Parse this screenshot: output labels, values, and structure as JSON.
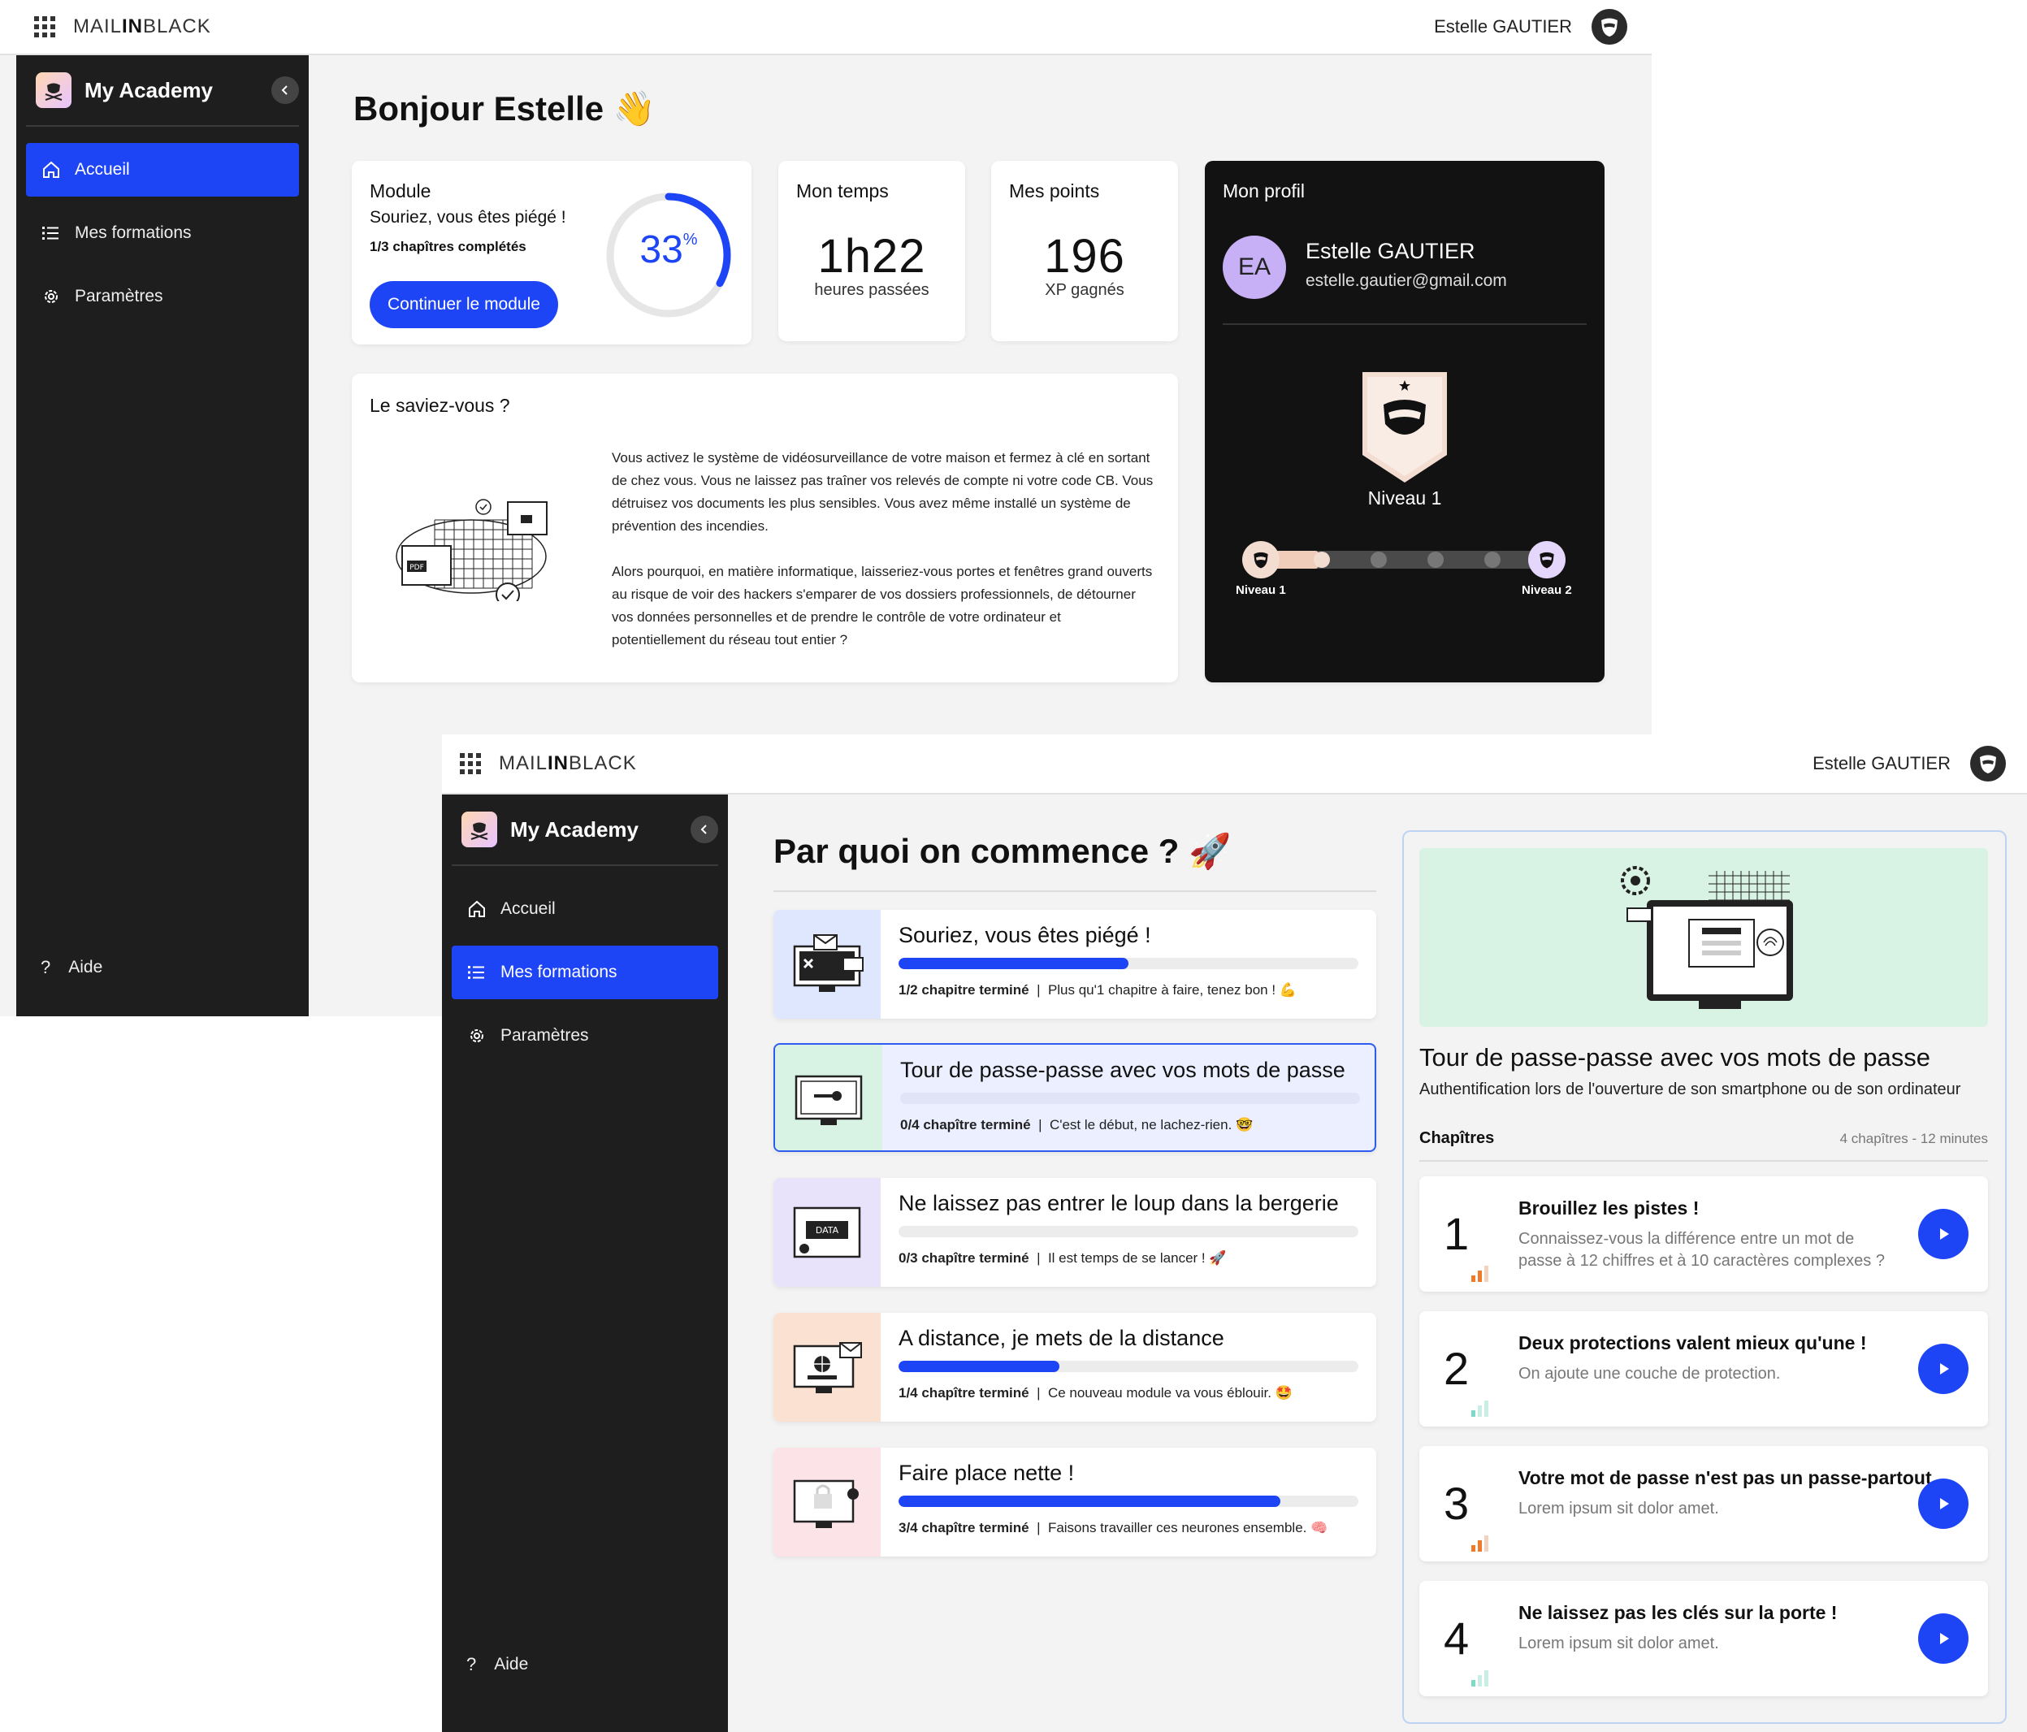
{
  "brand": {
    "prefix": "MAIL",
    "bold": "IN",
    "suffix": "BLACK"
  },
  "user": {
    "name": "Estelle GAUTIER"
  },
  "sidebar": {
    "title": "My Academy",
    "items": [
      {
        "label": "Accueil"
      },
      {
        "label": "Mes formations"
      },
      {
        "label": "Paramètres"
      }
    ],
    "help": "Aide"
  },
  "dashboard": {
    "greeting": "Bonjour Estelle",
    "greeting_emoji": "👋",
    "module": {
      "title": "Module",
      "name": "Souriez, vous êtes piégé !",
      "chapters": "1/3 chapîtres complétés",
      "button": "Continuer le module",
      "progress_value": "33",
      "progress_unit": "%",
      "progress_fraction": 0.33
    },
    "time": {
      "title": "Mon temps",
      "value": "1h22",
      "caption": "heures passées"
    },
    "points": {
      "title": "Mes points",
      "value": "196",
      "caption": "XP gagnés"
    },
    "tip": {
      "title": "Le saviez-vous ?",
      "para1": "Vous activez le système de vidéosurveillance de votre maison et fermez à clé en sortant de chez vous. Vous ne laissez pas traîner vos relevés de compte ni votre code CB. Vous détruisez vos documents les plus sensibles. Vous avez même installé un système de prévention des incendies.",
      "para2": "Alors pourquoi, en matière informatique, laisseriez-vous portes et fenêtres grand ouverts au risque de voir des hackers s'emparer de vos dossiers professionnels, de détourner vos données personnelles et de prendre le contrôle de votre ordinateur et potentiellement du réseau tout entier ?",
      "pdf_label": "PDF"
    },
    "profile": {
      "title": "Mon profil",
      "initials": "EA",
      "name": "Estelle GAUTIER",
      "email": "estelle.gautier@gmail.com",
      "level": "Niveau 1",
      "level_from": "Niveau 1",
      "level_to": "Niveau 2",
      "level_progress_fraction": 0.2
    }
  },
  "formations": {
    "title": "Par quoi on commence ?",
    "title_emoji": "🚀",
    "modules": [
      {
        "title": "Souriez, vous êtes piégé !",
        "chapters": "1/2 chapitre terminé",
        "message": "Plus qu'1 chapitre à faire, tenez bon !",
        "emoji": "💪",
        "progress": 0.5,
        "color": "#dfe7ff"
      },
      {
        "title": "Tour de passe-passe avec vos mots de passe",
        "chapters": "0/4 chapître terminé",
        "message": "C'est le début, ne lachez-rien.",
        "emoji": "🤓",
        "progress": 0.0,
        "color": "#d8f3e4"
      },
      {
        "title": "Ne laissez pas entrer le loup dans la bergerie",
        "chapters": "0/3 chapître terminé",
        "message": "Il est temps de se lancer !",
        "emoji": "🚀",
        "progress": 0.0,
        "color": "#e8e2fb",
        "thumb_label": "DATA"
      },
      {
        "title": "A distance, je mets de la distance",
        "chapters": "1/4 chapître terminé",
        "message": "Ce nouveau module va vous éblouir.",
        "emoji": "🤩",
        "progress": 0.35,
        "color": "#fbe1d2"
      },
      {
        "title": "Faire place nette !",
        "chapters": "3/4 chapître terminé",
        "message": "Faisons travailler ces neurones ensemble.",
        "emoji": "🧠",
        "progress": 0.83,
        "color": "#fbe3e8"
      }
    ],
    "detail": {
      "title": "Tour de passe-passe avec vos mots de passe",
      "subtitle": "Authentification lors de l'ouverture de son smartphone ou de son ordinateur",
      "chapters_label": "Chapîtres",
      "chapters_meta": "4 chapîtres - 12 minutes",
      "banner_color": "#d8f3e4",
      "chapters": [
        {
          "num": "1",
          "title": "Brouillez les pistes !",
          "desc": "Connaissez-vous la différence entre un mot de passe à 12 chiffres et à 10 caractères complexes ?",
          "difficulty": "orange"
        },
        {
          "num": "2",
          "title": "Deux protections valent mieux qu'une !",
          "desc": "On ajoute une couche de protection.",
          "difficulty": "teal"
        },
        {
          "num": "3",
          "title": "Votre mot de passe n'est pas un passe-partout",
          "desc": "Lorem ipsum sit dolor amet.",
          "difficulty": "orange"
        },
        {
          "num": "4",
          "title": "Ne laissez pas les clés sur la porte !",
          "desc": "Lorem ipsum sit dolor amet.",
          "difficulty": "teal"
        }
      ]
    }
  },
  "colors": {
    "accent": "#1e45f5",
    "sidebar": "#1e1e1e",
    "background": "#f3f3f3"
  }
}
